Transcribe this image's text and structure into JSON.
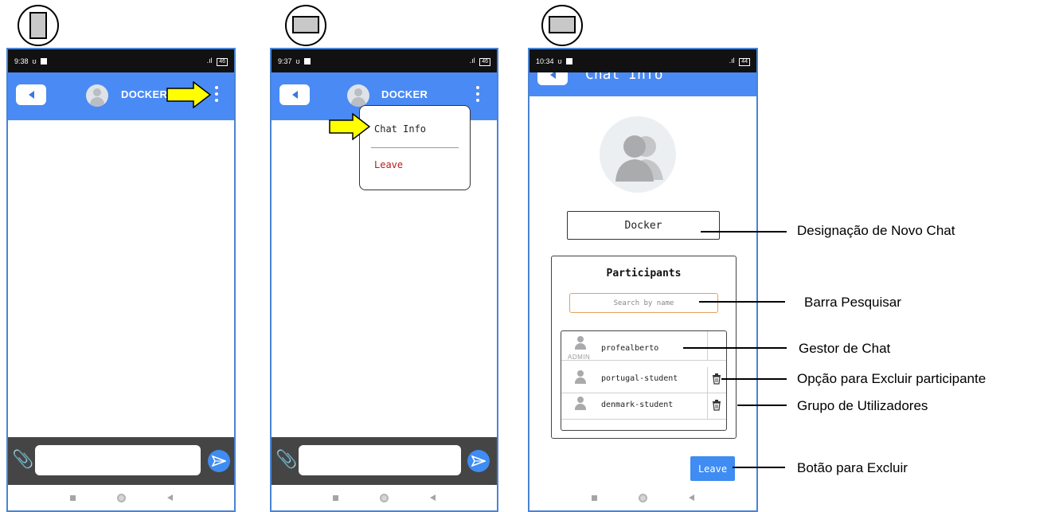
{
  "step_markers": [
    {
      "id": "step1",
      "icon": "portrait-rectangle-icon"
    },
    {
      "id": "step2",
      "icon": "landscape-rectangle-icon"
    },
    {
      "id": "step3",
      "icon": "landscape-rectangle-icon"
    }
  ],
  "screen1": {
    "status_time": "9:38",
    "battery": "46",
    "chat_name": "DOCKER"
  },
  "screen2": {
    "status_time": "9:37",
    "battery": "46",
    "chat_name": "DOCKER",
    "menu": {
      "chat_info_label": "Chat Info",
      "leave_label": "Leave"
    }
  },
  "screen3": {
    "status_time": "10:34",
    "battery": "44",
    "title": "Chat Info",
    "chat_name_value": "Docker",
    "participants_title": "Participants",
    "search_placeholder": "Search by name",
    "participants": [
      {
        "name": "profealberto",
        "role": "ADMIN",
        "deletable": false
      },
      {
        "name": "portugal-student",
        "role": "",
        "deletable": true
      },
      {
        "name": "denmark-student",
        "role": "",
        "deletable": true
      }
    ],
    "leave_button": "Leave"
  },
  "callouts": {
    "chat_name": "Designação  de Novo  Chat",
    "search_bar": "Barra  Pesquisar",
    "chat_manager": "Gestor de  Chat",
    "delete_option": "Opção para Excluir participante",
    "user_group": "Grupo de Utilizadores",
    "leave_button": "Botão para Excluir"
  },
  "colors": {
    "appbar": "#4a8af4",
    "composer": "#454545",
    "send": "#3f8cf2",
    "highlight_arrow": "#ffff00",
    "leave_text": "#b71c1c"
  }
}
